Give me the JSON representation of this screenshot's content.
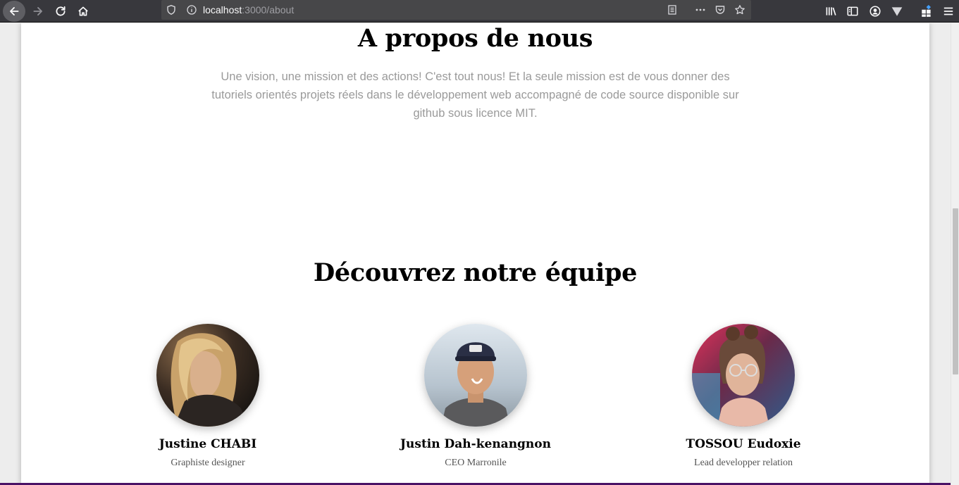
{
  "browser": {
    "url_host": "localhost",
    "url_path": ":3000/about"
  },
  "about": {
    "title": "A propos de nous",
    "description": "Une vision, une mission et des actions! C'est tout nous! Et la seule mission est de vous donner des tutoriels orientés projets réels dans le développement web accompagné de code source disponible sur github sous licence MIT."
  },
  "team": {
    "title": "Découvrez notre équipe",
    "members": [
      {
        "name": "Justine CHABI",
        "role": "Graphiste designer"
      },
      {
        "name": "Justin Dah-kenangnon",
        "role": "CEO Marronile"
      },
      {
        "name": "TOSSOU Eudoxie",
        "role": "Lead developper relation"
      }
    ]
  },
  "colors": {
    "toolbar_bg": "#38383d",
    "page_bg": "#ffffff",
    "accent_bottom": "#4a1266"
  }
}
